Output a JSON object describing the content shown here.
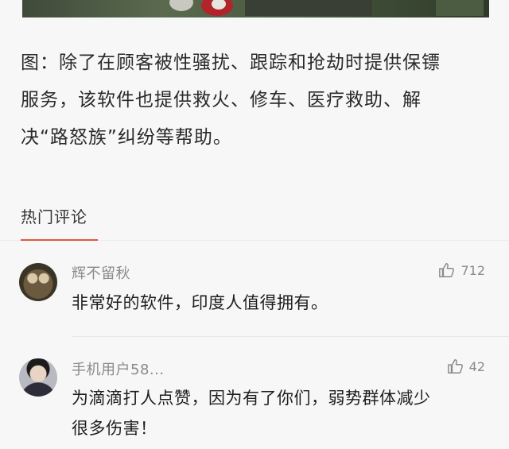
{
  "caption": {
    "line1": "图：除了在顾客被性骚扰、跟踪和抢劫时提供保镖",
    "line2": "服务，该软件也提供救火、修车、医疗救助、解",
    "line3": "决“路怒族”纠纷等帮助。"
  },
  "section": {
    "title": "热门评论",
    "accent_color": "#e0573e"
  },
  "comments": [
    {
      "username": "辉不留秋",
      "avatar_icon": "owl-avatar",
      "likes": "712",
      "text_lines": [
        "非常好的软件，印度人值得拥有。"
      ]
    },
    {
      "username": "手机用户58...",
      "avatar_icon": "person-avatar",
      "likes": "42",
      "text_lines": [
        "为滴滴打人点赞，因为有了你们，弱势群体减少",
        "很多伤害！"
      ]
    }
  ]
}
